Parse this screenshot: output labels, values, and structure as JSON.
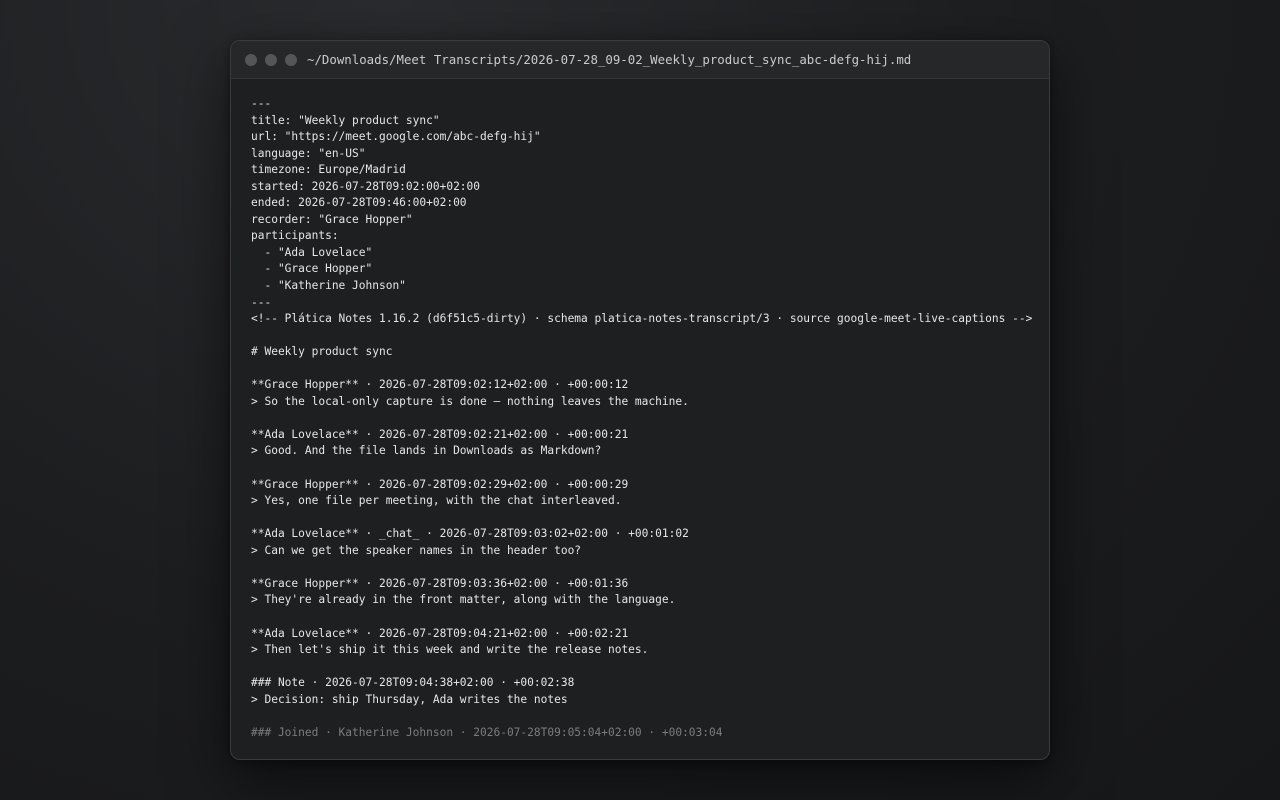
{
  "window": {
    "title": "~/Downloads/Meet Transcripts/2026-07-28_09-02_Weekly_product_sync_abc-defg-hij.md"
  },
  "document": {
    "lines": [
      {
        "text": "---"
      },
      {
        "text": "title: \"Weekly product sync\""
      },
      {
        "text": "url: \"https://meet.google.com/abc-defg-hij\""
      },
      {
        "text": "language: \"en-US\""
      },
      {
        "text": "timezone: Europe/Madrid"
      },
      {
        "text": "started: 2026-07-28T09:02:00+02:00"
      },
      {
        "text": "ended: 2026-07-28T09:46:00+02:00"
      },
      {
        "text": "recorder: \"Grace Hopper\""
      },
      {
        "text": "participants:"
      },
      {
        "text": "  - \"Ada Lovelace\""
      },
      {
        "text": "  - \"Grace Hopper\""
      },
      {
        "text": "  - \"Katherine Johnson\""
      },
      {
        "text": "---"
      },
      {
        "text": "<!-- Plática Notes 1.16.2 (d6f51c5-dirty) · schema platica-notes-transcript/3 · source google-meet-live-captions -->"
      },
      {
        "text": ""
      },
      {
        "text": "# Weekly product sync"
      },
      {
        "text": ""
      },
      {
        "text": "**Grace Hopper** · 2026-07-28T09:02:12+02:00 · +00:00:12"
      },
      {
        "text": "> So the local-only capture is done — nothing leaves the machine."
      },
      {
        "text": ""
      },
      {
        "text": "**Ada Lovelace** · 2026-07-28T09:02:21+02:00 · +00:00:21"
      },
      {
        "text": "> Good. And the file lands in Downloads as Markdown?"
      },
      {
        "text": ""
      },
      {
        "text": "**Grace Hopper** · 2026-07-28T09:02:29+02:00 · +00:00:29"
      },
      {
        "text": "> Yes, one file per meeting, with the chat interleaved."
      },
      {
        "text": ""
      },
      {
        "text": "**Ada Lovelace** · _chat_ · 2026-07-28T09:03:02+02:00 · +00:01:02"
      },
      {
        "text": "> Can we get the speaker names in the header too?"
      },
      {
        "text": ""
      },
      {
        "text": "**Grace Hopper** · 2026-07-28T09:03:36+02:00 · +00:01:36"
      },
      {
        "text": "> They're already in the front matter, along with the language."
      },
      {
        "text": ""
      },
      {
        "text": "**Ada Lovelace** · 2026-07-28T09:04:21+02:00 · +00:02:21"
      },
      {
        "text": "> Then let's ship it this week and write the release notes."
      },
      {
        "text": ""
      },
      {
        "text": "### Note · 2026-07-28T09:04:38+02:00 · +00:02:38"
      },
      {
        "text": "> Decision: ship Thursday, Ada writes the notes"
      },
      {
        "text": ""
      },
      {
        "text": "### Joined · Katherine Johnson · 2026-07-28T09:05:04+02:00 · +00:03:04",
        "dim": true
      }
    ]
  },
  "colors": {
    "text": "#e6e6e8",
    "dim_text": "#7b7c80",
    "window_bg": "#1e1f21",
    "titlebar_bg": "#262729"
  }
}
